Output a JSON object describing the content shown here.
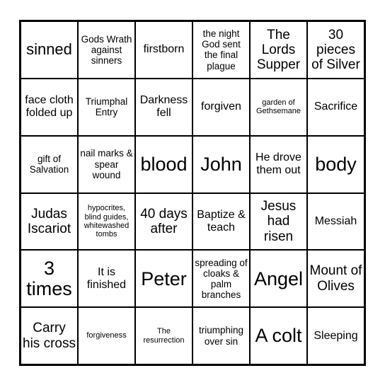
{
  "board": {
    "columns": 6,
    "rows": 6,
    "cells": [
      {
        "text": "sinned",
        "size": "xl"
      },
      {
        "text": "Gods Wrath against sinners",
        "size": "sm"
      },
      {
        "text": "firstborn",
        "size": "md"
      },
      {
        "text": "the night God sent the final plague",
        "size": "sm"
      },
      {
        "text": "The Lords Supper",
        "size": "lg"
      },
      {
        "text": "30 pieces of Silver",
        "size": "lg"
      },
      {
        "text": "face cloth folded up",
        "size": "md"
      },
      {
        "text": "Triumphal Entry",
        "size": "sm"
      },
      {
        "text": "Darkness fell",
        "size": "md"
      },
      {
        "text": "forgiven",
        "size": "md"
      },
      {
        "text": "garden of Gethsemane",
        "size": "xs"
      },
      {
        "text": "Sacrifice",
        "size": "md"
      },
      {
        "text": "gift of Salvation",
        "size": "sm"
      },
      {
        "text": "nail marks & spear wound",
        "size": "sm"
      },
      {
        "text": "blood",
        "size": "xxl"
      },
      {
        "text": "John",
        "size": "xxl"
      },
      {
        "text": "He drove them out",
        "size": "md"
      },
      {
        "text": "body",
        "size": "xxl"
      },
      {
        "text": "Judas Iscariot",
        "size": "lg"
      },
      {
        "text": "hypocrites, blind guides, whitewashed tombs",
        "size": "xs"
      },
      {
        "text": "40 days after",
        "size": "lg"
      },
      {
        "text": "Baptize & teach",
        "size": "md"
      },
      {
        "text": "Jesus had risen",
        "size": "lg"
      },
      {
        "text": "Messiah",
        "size": "md"
      },
      {
        "text": "3 times",
        "size": "xxl"
      },
      {
        "text": "It is finished",
        "size": "md"
      },
      {
        "text": "Peter",
        "size": "xxl"
      },
      {
        "text": "spreading of cloaks & palm branches",
        "size": "sm"
      },
      {
        "text": "Angel",
        "size": "xxl"
      },
      {
        "text": "Mount of Olives",
        "size": "lg"
      },
      {
        "text": "Carry his cross",
        "size": "lg"
      },
      {
        "text": "forgiveness",
        "size": "xs"
      },
      {
        "text": "The resurrection",
        "size": "xs"
      },
      {
        "text": "triumphing over sin",
        "size": "sm"
      },
      {
        "text": "A colt",
        "size": "xxl"
      },
      {
        "text": "Sleeping",
        "size": "md"
      }
    ]
  }
}
